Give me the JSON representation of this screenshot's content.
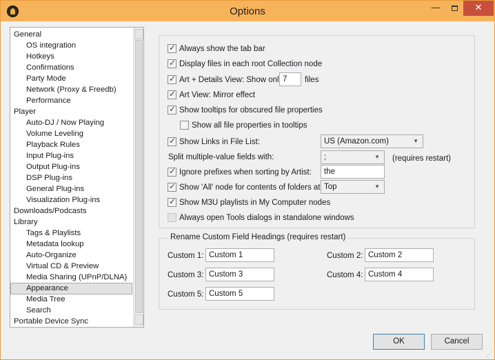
{
  "window": {
    "title": "Options",
    "minimize_glyph": "—",
    "close_glyph": "✕"
  },
  "tree": {
    "items": [
      {
        "label": "General",
        "level": 0
      },
      {
        "label": "OS integration",
        "level": 1
      },
      {
        "label": "Hotkeys",
        "level": 1
      },
      {
        "label": "Confirmations",
        "level": 1
      },
      {
        "label": "Party Mode",
        "level": 1
      },
      {
        "label": "Network (Proxy & Freedb)",
        "level": 1
      },
      {
        "label": "Performance",
        "level": 1
      },
      {
        "label": "Player",
        "level": 0
      },
      {
        "label": "Auto-DJ / Now Playing",
        "level": 1
      },
      {
        "label": "Volume Leveling",
        "level": 1
      },
      {
        "label": "Playback Rules",
        "level": 1
      },
      {
        "label": "Input Plug-ins",
        "level": 1
      },
      {
        "label": "Output Plug-ins",
        "level": 1
      },
      {
        "label": "DSP Plug-ins",
        "level": 1
      },
      {
        "label": "General Plug-ins",
        "level": 1
      },
      {
        "label": "Visualization Plug-ins",
        "level": 1
      },
      {
        "label": "Downloads/Podcasts",
        "level": 0
      },
      {
        "label": "Library",
        "level": 0
      },
      {
        "label": "Tags & Playlists",
        "level": 1
      },
      {
        "label": "Metadata lookup",
        "level": 1
      },
      {
        "label": "Auto-Organize",
        "level": 1
      },
      {
        "label": "Virtual CD & Preview",
        "level": 1
      },
      {
        "label": "Media Sharing (UPnP/DLNA)",
        "level": 1
      },
      {
        "label": "Appearance",
        "level": 1,
        "selected": true
      },
      {
        "label": "Media Tree",
        "level": 1
      },
      {
        "label": "Search",
        "level": 1
      },
      {
        "label": "Portable Device Sync",
        "level": 0
      }
    ]
  },
  "options": {
    "tab_bar": {
      "label": "Always show the tab bar",
      "checked": true
    },
    "root_files": {
      "label": "Display files in each root Collection node",
      "checked": true
    },
    "art_details": {
      "label": "Art + Details View: Show only",
      "checked": true,
      "value": "7",
      "suffix": "files"
    },
    "mirror": {
      "label": "Art View: Mirror effect",
      "checked": true
    },
    "tooltips": {
      "label": "Show tooltips for obscured file properties",
      "checked": true
    },
    "all_props": {
      "label": "Show all file properties in tooltips",
      "checked": false
    },
    "links": {
      "label": "Show Links in File List:",
      "checked": true,
      "selected": "US (Amazon.com)"
    },
    "split": {
      "label": "Split multiple-value fields with:",
      "selected": ";",
      "note": "(requires restart)"
    },
    "prefixes": {
      "label": "Ignore prefixes when sorting by Artist:",
      "checked": true,
      "value": "the"
    },
    "all_node": {
      "label": "Show 'All' node for contents of folders at",
      "checked": true,
      "selected": "Top"
    },
    "m3u": {
      "label": "Show M3U playlists in My Computer nodes",
      "checked": true
    },
    "tools_dialogs": {
      "label": "Always open Tools dialogs in standalone windows",
      "checked": false,
      "disabled": true
    }
  },
  "rename": {
    "legend": "Rename Custom Field Headings (requires restart)",
    "fields": [
      {
        "label": "Custom 1:",
        "value": "Custom 1"
      },
      {
        "label": "Custom 2:",
        "value": "Custom 2"
      },
      {
        "label": "Custom 3:",
        "value": "Custom 3"
      },
      {
        "label": "Custom 4:",
        "value": "Custom 4"
      },
      {
        "label": "Custom 5:",
        "value": "Custom 5"
      }
    ]
  },
  "buttons": {
    "ok": "OK",
    "cancel": "Cancel"
  },
  "colors": {
    "titlebar": "#f7b35a",
    "close": "#c7503d"
  }
}
